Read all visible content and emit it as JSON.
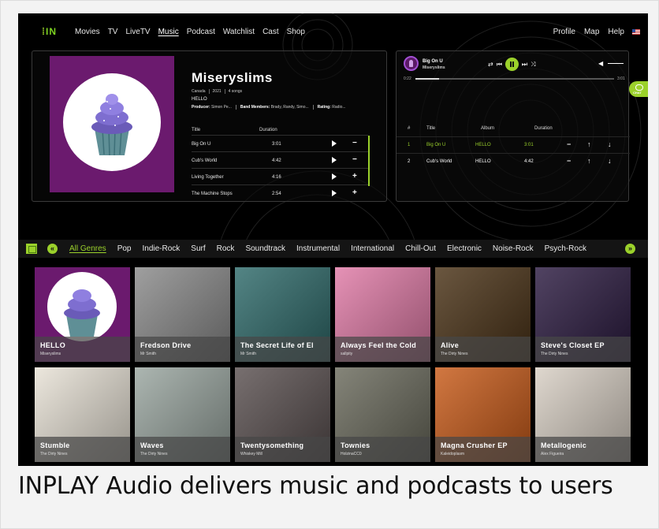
{
  "nav": {
    "logo": "IN",
    "items": [
      "Movies",
      "TV",
      "LiveTV",
      "Music",
      "Podcast",
      "Watchlist",
      "Cast",
      "Shop"
    ],
    "active": "Music",
    "right": [
      "Profile",
      "Map",
      "Help"
    ]
  },
  "album": {
    "title": "Miseryslims",
    "meta": [
      "Canada",
      "2021",
      "4 songs"
    ],
    "subtitle": "HELLO",
    "credits": [
      {
        "label": "Producer:",
        "value": "Simon Pe..."
      },
      {
        "label": "Band Members:",
        "value": "Brady, Randy, Simo..."
      },
      {
        "label": "Rating:",
        "value": "Radio..."
      }
    ],
    "col_title": "Title",
    "col_duration": "Duration",
    "tracks": [
      {
        "title": "Big On U",
        "duration": "3:01",
        "action": "−"
      },
      {
        "title": "Cub's World",
        "duration": "4:42",
        "action": "−"
      },
      {
        "title": "Living Together",
        "duration": "4:16",
        "action": "+"
      },
      {
        "title": "The Machine Stops",
        "duration": "2:54",
        "action": "+"
      }
    ]
  },
  "player": {
    "now_title": "Big On U",
    "now_artist": "Miseryslims",
    "elapsed": "0:22",
    "total": "3:01",
    "progress": 0.12,
    "queue_headers": {
      "num": "#",
      "title": "Title",
      "album": "Album",
      "duration": "Duration"
    },
    "queue": [
      {
        "num": "1",
        "title": "Big On U",
        "album": "HELLO",
        "duration": "3:01",
        "playing": true
      },
      {
        "num": "2",
        "title": "Cub's World",
        "album": "HELLO",
        "duration": "4:42",
        "playing": false
      }
    ]
  },
  "chat": {
    "label": "CHAT"
  },
  "genres": {
    "items": [
      "All Genres",
      "Pop",
      "Indie-Rock",
      "Surf",
      "Rock",
      "Soundtrack",
      "Instrumental",
      "International",
      "Chill-Out",
      "Electronic",
      "Noise-Rock",
      "Psych-Rock"
    ],
    "active": "All Genres"
  },
  "albums": [
    {
      "name": "HELLO",
      "artist": "Miseryslims",
      "color": "#6b1a6e"
    },
    {
      "name": "Fredson Drive",
      "artist": "Mr Smith",
      "color": "#8a8a8a"
    },
    {
      "name": "The Secret Life of El",
      "artist": "Mr Smith",
      "color": "#2e6a6a"
    },
    {
      "name": "Always Feel the Cold",
      "artist": "sallpity",
      "color": "#e07aa6"
    },
    {
      "name": "Alive",
      "artist": "The Dirty Nines",
      "color": "#4a3216"
    },
    {
      "name": "Steve's Closet EP",
      "artist": "The Dirty Nines",
      "color": "#2b1a40"
    },
    {
      "name": "Stumble",
      "artist": "The Dirty Nines",
      "color": "#e8e2d6"
    },
    {
      "name": "Waves",
      "artist": "The Dirty Nines",
      "color": "#9aa6a0"
    },
    {
      "name": "Twentysomething",
      "artist": "Whiskey Mill",
      "color": "#5a5050"
    },
    {
      "name": "Townies",
      "artist": "HolzinaCC0",
      "color": "#6a6a5c"
    },
    {
      "name": "Magna Crusher EP",
      "artist": "Kaleidoplasm",
      "color": "#c85a18"
    },
    {
      "name": "Metallogenic",
      "artist": "Alex Figueira",
      "color": "#d8cfc4"
    }
  ],
  "caption": "INPLAY Audio delivers music and podcasts to users"
}
